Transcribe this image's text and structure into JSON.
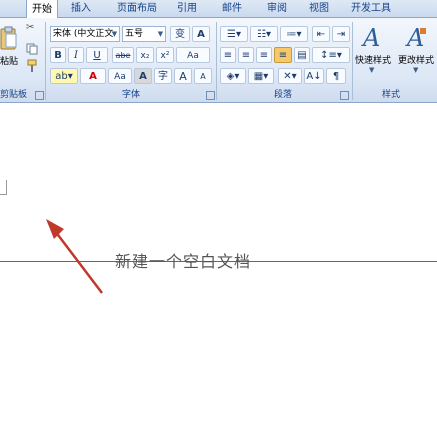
{
  "tabs": [
    {
      "label": "开始",
      "active": true
    },
    {
      "label": "插入",
      "active": false
    },
    {
      "label": "页面布局",
      "active": false
    },
    {
      "label": "引用",
      "active": false
    },
    {
      "label": "邮件",
      "active": false
    },
    {
      "label": "审阅",
      "active": false
    },
    {
      "label": "视图",
      "active": false
    },
    {
      "label": "开发工具",
      "active": false
    }
  ],
  "clipboard": {
    "paste_label": "粘贴",
    "group_label": "剪贴板"
  },
  "font": {
    "group_label": "字体",
    "font_name": "宋体 (中文正文",
    "font_size": "五号",
    "bold": "B",
    "italic": "I",
    "underline": "U",
    "strike": "abe",
    "subscript": "x₂",
    "superscript": "x²",
    "grow": "A",
    "shrink": "A",
    "clear": "Aa",
    "text_color_letter": "A",
    "char_shading": "A",
    "char_border": "A",
    "aa_label": "Aa"
  },
  "paragraph": {
    "group_label": "段落"
  },
  "styles": {
    "group_label": "样式",
    "quick_styles": "快速样式",
    "change_styles": "更改样式"
  },
  "document": {
    "annotation_text": "新建一个空白文档"
  },
  "colors": {
    "accent_red": "#d33333",
    "ribbon_text": "#15428b",
    "arrow": "#c0392b"
  }
}
